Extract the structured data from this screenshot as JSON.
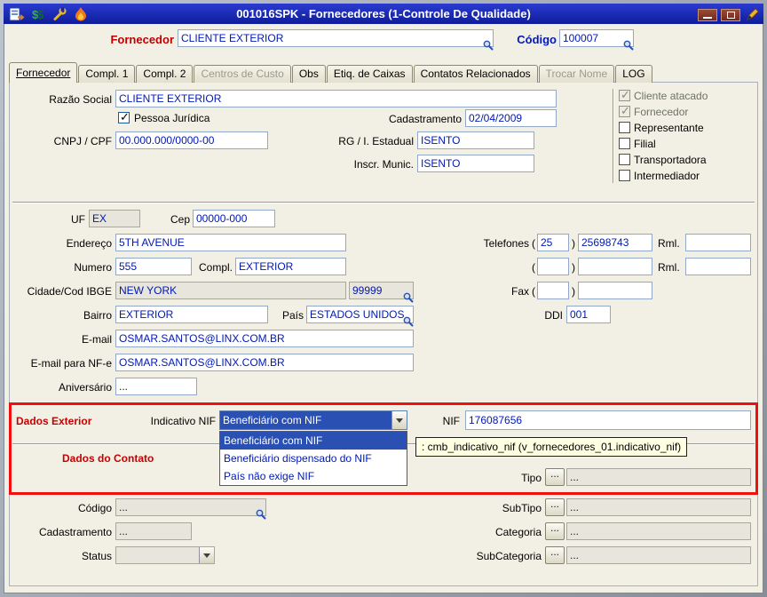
{
  "window": {
    "title": "001016SPK - Fornecedores (1-Controle De Qualidade)"
  },
  "header": {
    "fornecedor_label": "Fornecedor",
    "fornecedor_value": "CLIENTE EXTERIOR",
    "codigo_label": "Código",
    "codigo_value": "100007"
  },
  "tabs": [
    {
      "label": "Fornecedor",
      "state": "active"
    },
    {
      "label": "Compl. 1",
      "state": "enabled"
    },
    {
      "label": "Compl. 2",
      "state": "enabled"
    },
    {
      "label": "Centros de Custo",
      "state": "disabled"
    },
    {
      "label": "Obs",
      "state": "enabled"
    },
    {
      "label": "Etiq. de Caixas",
      "state": "enabled"
    },
    {
      "label": "Contatos Relacionados",
      "state": "enabled"
    },
    {
      "label": "Trocar Nome",
      "state": "disabled"
    },
    {
      "label": "LOG",
      "state": "enabled"
    }
  ],
  "identity": {
    "razao_social_label": "Razão Social",
    "razao_social_value": "CLIENTE EXTERIOR",
    "pessoa_juridica_label": "Pessoa Jurídica",
    "pessoa_juridica_checked": true,
    "cadastramento_label": "Cadastramento",
    "cadastramento_value": "02/04/2009",
    "cnpj_cpf_label": "CNPJ / CPF",
    "cnpj_cpf_value": "00.000.000/0000-00",
    "rg_ie_label": "RG / I. Estadual",
    "rg_ie_value": "ISENTO",
    "inscr_munic_label": "Inscr. Munic.",
    "inscr_munic_value": "ISENTO"
  },
  "roles": [
    {
      "label": "Cliente atacado",
      "checked": true,
      "disabled": true
    },
    {
      "label": "Fornecedor",
      "checked": true,
      "disabled": true
    },
    {
      "label": "Representante",
      "checked": false,
      "disabled": false
    },
    {
      "label": "Filial",
      "checked": false,
      "disabled": false
    },
    {
      "label": "Transportadora",
      "checked": false,
      "disabled": false
    },
    {
      "label": "Intermediador",
      "checked": false,
      "disabled": false
    }
  ],
  "address": {
    "uf_label": "UF",
    "uf_value": "EX",
    "cep_label": "Cep",
    "cep_value": "00000-000",
    "endereco_label": "Endereço",
    "endereco_value": "5TH AVENUE",
    "numero_label": "Numero",
    "numero_value": "555",
    "compl_label": "Compl.",
    "compl_value": "EXTERIOR",
    "cidade_label": "Cidade/Cod IBGE",
    "cidade_value": "NEW YORK",
    "cod_ibge_value": "99999",
    "bairro_label": "Bairro",
    "bairro_value": "EXTERIOR",
    "pais_label": "País",
    "pais_value": "ESTADOS UNIDOS",
    "ddi_label": "DDI",
    "ddi_value": "001",
    "email_label": "E-mail",
    "email_value": "OSMAR.SANTOS@LINX.COM.BR",
    "email_nfe_label": "E-mail para NF-e",
    "email_nfe_value": "OSMAR.SANTOS@LINX.COM.BR",
    "aniversario_label": "Aniversário",
    "aniversario_value": "...",
    "telefones_label": "Telefones",
    "fone1_ddd": "25",
    "fone1_numero": "25698743",
    "fone1_rml": "",
    "fone2_ddd": "",
    "fone2_numero": "",
    "fone2_rml": "",
    "rml_label": "Rml.",
    "fax_label": "Fax",
    "fax_ddd": "",
    "fax_numero": "",
    "paren_open": "(",
    "paren_close": ")"
  },
  "dados_exterior": {
    "section_label": "Dados Exterior",
    "indicativo_nif_label": "Indicativo NIF",
    "indicativo_nif_value": "Beneficiário com NIF",
    "indicativo_nif_options": [
      "Beneficiário com NIF",
      "Beneficiário dispensado do NIF",
      "País não exige NIF"
    ],
    "nif_label": "NIF",
    "nif_value": "176087656",
    "tooltip_text": ": cmb_indicativo_nif (v_fornecedores_01.indicativo_nif)"
  },
  "dados_contato": {
    "section_label": "Dados do Contato",
    "codigo_label": "Código",
    "codigo_value": "...",
    "cadastramento_label": "Cadastramento",
    "cadastramento_value": "...",
    "status_label": "Status",
    "status_value": "",
    "tipo_label": "Tipo",
    "tipo_button": "...",
    "tipo_value": "...",
    "subtipo_label": "SubTipo",
    "subtipo_button": "...",
    "subtipo_value": "...",
    "categoria_label": "Categoria",
    "categoria_button": "...",
    "categoria_value": "...",
    "subcategoria_label": "SubCategoria",
    "subcategoria_button": "...",
    "subcategoria_value": "..."
  },
  "colors": {
    "titlebar": "#1A28B0",
    "accent_red": "#C80000",
    "field_text": "#0018B4",
    "selection": "#2A50B4",
    "highlight_border": "#F01010",
    "tooltip_bg": "#FFFFE1"
  }
}
